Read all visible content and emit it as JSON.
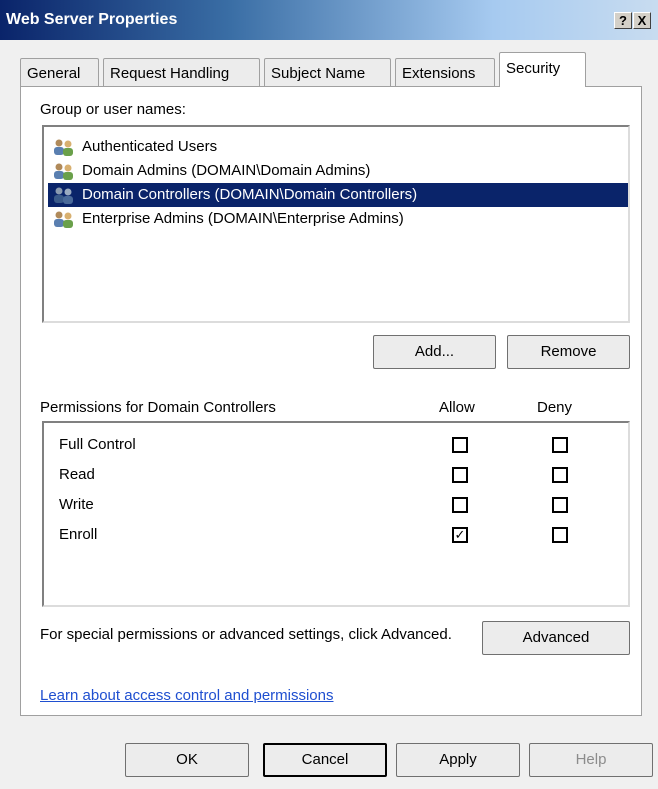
{
  "window": {
    "title": "Web Server Properties",
    "help_glyph": "?",
    "close_glyph": "X"
  },
  "tabs": [
    {
      "label": "General"
    },
    {
      "label": "Request Handling"
    },
    {
      "label": "Subject Name"
    },
    {
      "label": "Extensions"
    },
    {
      "label": "Security",
      "active": true
    }
  ],
  "groups": {
    "label": "Group or user names:",
    "items": [
      {
        "label": "Authenticated Users",
        "icon": "user-group-icon"
      },
      {
        "label": "Domain Admins (DOMAIN\\Domain Admins)",
        "icon": "user-group-icon"
      },
      {
        "label": "Domain Controllers (DOMAIN\\Domain Controllers)",
        "icon": "user-group-icon",
        "selected": true
      },
      {
        "label": "Enterprise Admins (DOMAIN\\Enterprise Admins)",
        "icon": "user-group-icon"
      }
    ],
    "add_label": "Add...",
    "remove_label": "Remove"
  },
  "permissions": {
    "header": "Permissions for Domain Controllers",
    "allow_header": "Allow",
    "deny_header": "Deny",
    "rows": [
      {
        "name": "Full Control",
        "allow": false,
        "deny": false
      },
      {
        "name": "Read",
        "allow": false,
        "deny": false
      },
      {
        "name": "Write",
        "allow": false,
        "deny": false
      },
      {
        "name": "Enroll",
        "allow": true,
        "deny": false
      }
    ],
    "check_glyph": "✓"
  },
  "advanced": {
    "text": "For special permissions or advanced settings, click Advanced.",
    "button_label": "Advanced"
  },
  "learn_link": "Learn about access control and permissions",
  "footer": {
    "ok": "OK",
    "cancel": "Cancel",
    "apply": "Apply",
    "help": "Help"
  },
  "colors": {
    "selection": "#0a246a",
    "link": "#1f4fd0"
  }
}
